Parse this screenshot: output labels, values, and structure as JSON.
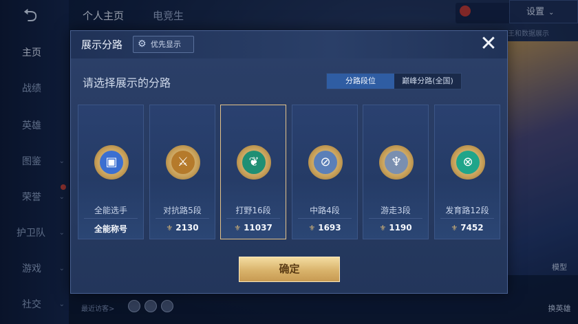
{
  "nav": {
    "back": "⮌"
  },
  "sidebar": {
    "items": [
      {
        "label": "主页",
        "active": true,
        "chevron": false
      },
      {
        "label": "战绩",
        "active": false,
        "chevron": false
      },
      {
        "label": "英雄",
        "active": false,
        "chevron": false
      },
      {
        "label": "图鉴",
        "active": false,
        "chevron": true
      },
      {
        "label": "荣誉",
        "active": false,
        "chevron": true
      },
      {
        "label": "护卫队",
        "active": false,
        "chevron": true
      },
      {
        "label": "游戏",
        "active": false,
        "chevron": true
      },
      {
        "label": "社交",
        "active": false,
        "chevron": true
      }
    ]
  },
  "topbar": {
    "tabs": [
      "个人主页",
      "电竞生"
    ],
    "settings_label": "设置",
    "side_text": "王和数据展示"
  },
  "right_buttons": {
    "model": "模型",
    "change_hero": "换英雄"
  },
  "bottom": {
    "visitors_label": "最近访客>"
  },
  "modal": {
    "title": "展示分路",
    "priority_label": "优先显示",
    "close": "✕",
    "subtitle": "请选择展示的分路",
    "segments": [
      {
        "label": "分路段位",
        "active": true
      },
      {
        "label": "巅峰分路(全国)",
        "active": false
      }
    ],
    "cards": [
      {
        "name": "全能选手",
        "value": "全能称号",
        "icon": "all-round-emblem-icon",
        "show_icon": false,
        "selected": false,
        "color": "#3b6fd1",
        "glyph": "▣"
      },
      {
        "name": "对抗路5段",
        "value": "2130",
        "icon": "clash-lane-emblem-icon",
        "show_icon": true,
        "selected": false,
        "color": "#b57a2b",
        "glyph": "⚔"
      },
      {
        "name": "打野16段",
        "value": "11037",
        "icon": "jungle-emblem-icon",
        "show_icon": true,
        "selected": true,
        "color": "#1f8f74",
        "glyph": "❦"
      },
      {
        "name": "中路4段",
        "value": "1693",
        "icon": "mid-lane-emblem-icon",
        "show_icon": true,
        "selected": false,
        "color": "#5b7fb8",
        "glyph": "⊘"
      },
      {
        "name": "游走3段",
        "value": "1190",
        "icon": "roam-emblem-icon",
        "show_icon": true,
        "selected": false,
        "color": "#7a8fb0",
        "glyph": "♆"
      },
      {
        "name": "发育路12段",
        "value": "7452",
        "icon": "farm-lane-emblem-icon",
        "show_icon": true,
        "selected": false,
        "color": "#1fa58a",
        "glyph": "⊗"
      }
    ],
    "confirm_label": "确定"
  },
  "colors": {
    "accent": "#2f5da3",
    "gold": "#d9b36b",
    "selected_border": "#e6c48a"
  }
}
